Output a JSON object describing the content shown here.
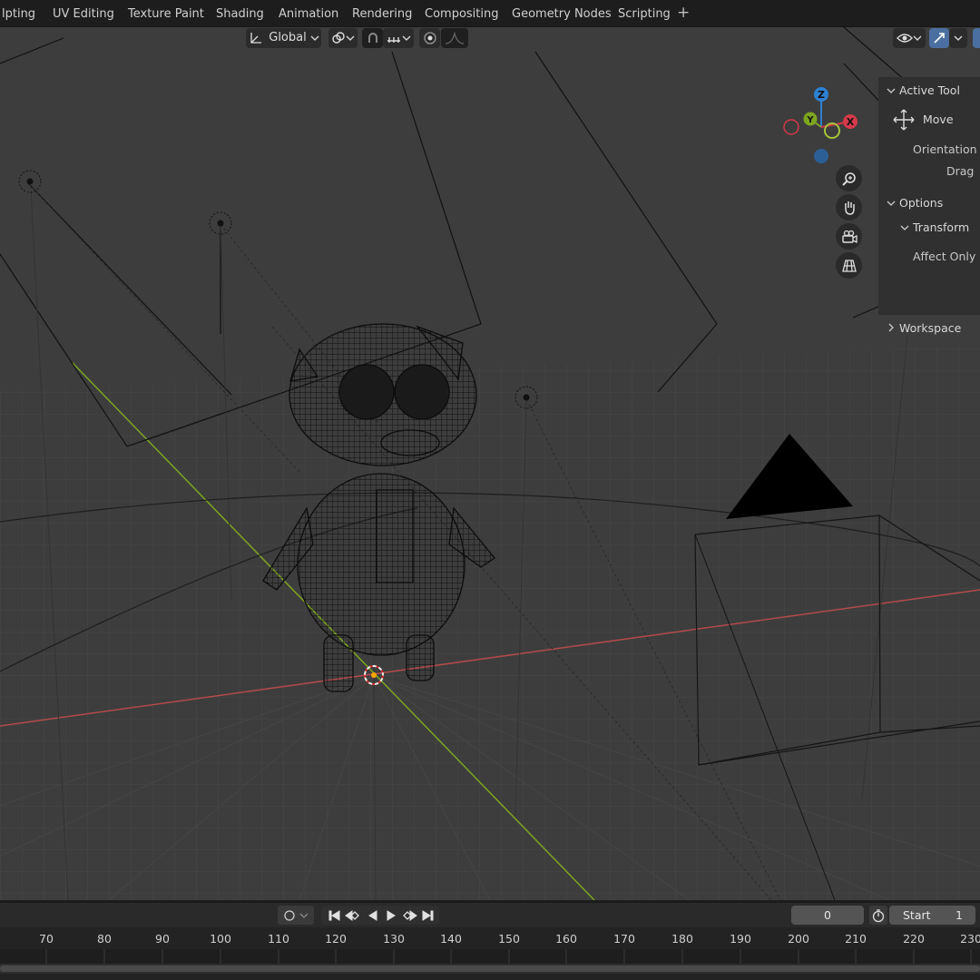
{
  "workspace_tabs": [
    {
      "label": "lpting"
    },
    {
      "label": "UV Editing"
    },
    {
      "label": "Texture Paint"
    },
    {
      "label": "Shading"
    },
    {
      "label": "Animation"
    },
    {
      "label": "Rendering"
    },
    {
      "label": "Compositing"
    },
    {
      "label": "Geometry Nodes"
    },
    {
      "label": "Scripting"
    }
  ],
  "add_tab_symbol": "+",
  "viewport_header": {
    "transform_orientation": "Global",
    "transform_orientation_icon": "orientation-icon",
    "pivot_icon": "link-icon",
    "snap_icon": "magnet-icon",
    "snap_target_icon": "snap-increment-icon",
    "proportional_icon": "proportional-edit-icon",
    "falloff_icon": "falloff-curve-icon",
    "visibility_icon": "eye-icon",
    "gizmo_icon": "gizmo-icon"
  },
  "gizmo": {
    "axes": [
      "Z",
      "Y",
      "X"
    ],
    "colors": {
      "x": "#d33a4a",
      "y": "#7ea521",
      "z": "#2e80d1"
    }
  },
  "nav_buttons": [
    "zoom-icon",
    "hand-icon",
    "camera-icon",
    "perspective-grid-icon"
  ],
  "side_panel": {
    "active_tool_header": "Active Tool",
    "tool_name": "Move",
    "orientation_label": "Orientation",
    "drag_label": "Drag",
    "options_header": "Options",
    "transform_header": "Transform",
    "affect_only_label": "Affect Only",
    "workspace_header": "Workspace"
  },
  "timeline": {
    "current_frame": "0",
    "start_label": "Start",
    "start_value": "1",
    "ruler_ticks": [
      "70",
      "80",
      "90",
      "100",
      "110",
      "120",
      "130",
      "140",
      "150",
      "160",
      "170",
      "180",
      "190",
      "200",
      "210",
      "220",
      "230"
    ]
  },
  "colors": {
    "viewport_bg": "#3d3d3d",
    "x_axis": "#b34a4d",
    "y_axis": "#7ea521",
    "accent": "#4a6fa0"
  }
}
